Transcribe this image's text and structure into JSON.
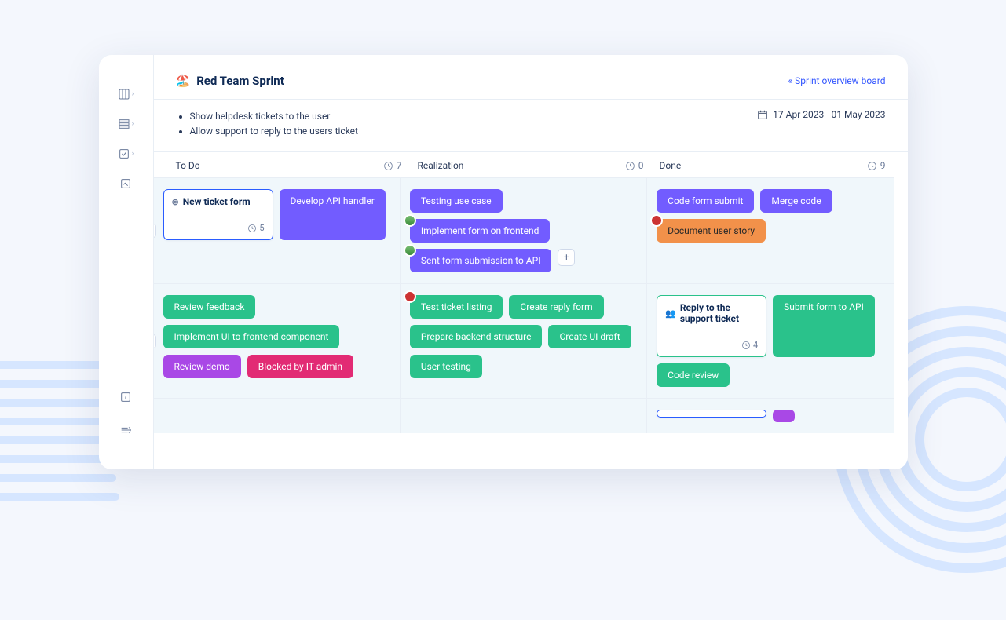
{
  "header": {
    "emoji": "🏖️",
    "title": "Red Team Sprint",
    "overview_link": "« Sprint overview board"
  },
  "goals": [
    "Show helpdesk tickets to the user",
    "Allow support to reply to the users ticket"
  ],
  "date_range": "17 Apr 2023 - 01 May 2023",
  "columns": [
    {
      "name": "To Do",
      "count": "7"
    },
    {
      "name": "Realization",
      "count": "0"
    },
    {
      "name": "Done",
      "count": "9"
    }
  ],
  "lanes": [
    {
      "id": "lane1",
      "cols": [
        {
          "items": [
            {
              "type": "card",
              "icon": "⊚",
              "title": "New ticket form",
              "meta": "5"
            },
            {
              "type": "chip",
              "color": "purple",
              "label": "Develop API handler"
            }
          ]
        },
        {
          "items": [
            {
              "type": "chip",
              "color": "purple",
              "label": "Testing use case"
            },
            {
              "type": "chip",
              "color": "purple",
              "avatar": "g",
              "label": "Implement form on frontend"
            },
            {
              "type": "chip",
              "color": "purple",
              "avatar": "g",
              "label": "Sent form submission to API"
            },
            {
              "type": "add"
            }
          ]
        },
        {
          "items": [
            {
              "type": "chip",
              "color": "purple",
              "label": "Code form submit"
            },
            {
              "type": "chip",
              "color": "purple",
              "label": "Merge code"
            },
            {
              "type": "chip",
              "color": "orange",
              "avatar": "r",
              "label": "Document user story"
            }
          ]
        }
      ]
    },
    {
      "id": "lane2",
      "cols": [
        {
          "items": [
            {
              "type": "chip",
              "color": "green",
              "label": "Review feedback"
            },
            {
              "type": "chip",
              "color": "green",
              "label": "Implement UI to frontend component"
            },
            {
              "type": "chip",
              "color": "violet",
              "label": "Review demo"
            },
            {
              "type": "chip",
              "color": "pink",
              "label": "Blocked by IT admin"
            }
          ]
        },
        {
          "items": [
            {
              "type": "chip",
              "color": "green",
              "avatar": "r",
              "label": "Test ticket listing"
            },
            {
              "type": "chip",
              "color": "green",
              "label": "Create reply form"
            },
            {
              "type": "chip",
              "color": "green",
              "label": "Prepare backend structure"
            },
            {
              "type": "chip",
              "color": "green",
              "label": "Create UI draft"
            },
            {
              "type": "chip",
              "color": "green",
              "label": "User testing"
            }
          ]
        },
        {
          "items": [
            {
              "type": "card",
              "icon": "👥",
              "title": "Reply to the support ticket",
              "meta": "4"
            },
            {
              "type": "chip",
              "color": "green",
              "label": "Submit form to API"
            },
            {
              "type": "chip",
              "color": "green",
              "label": "Code review"
            }
          ]
        }
      ]
    },
    {
      "id": "lane3",
      "cols": [
        {
          "items": []
        },
        {
          "items": []
        },
        {
          "items": [
            {
              "type": "card_stub"
            },
            {
              "type": "chip",
              "color": "violet",
              "label": " "
            }
          ]
        }
      ]
    }
  ]
}
